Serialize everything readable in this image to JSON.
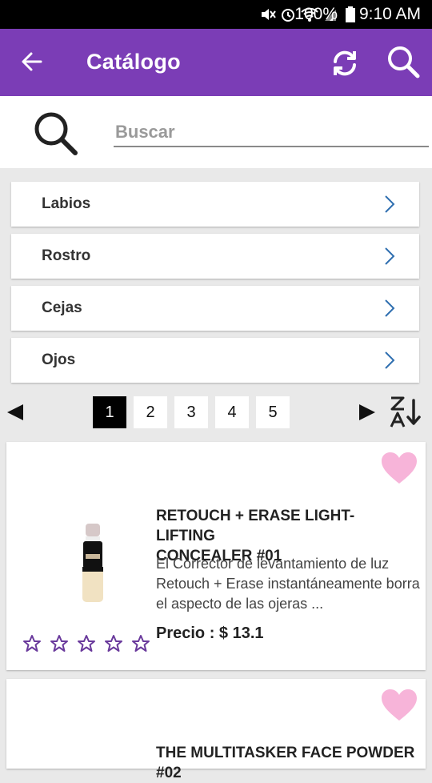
{
  "status": {
    "battery": "100%",
    "time": "9:10 AM"
  },
  "appbar": {
    "title": "Catálogo"
  },
  "search": {
    "placeholder": "Buscar"
  },
  "categories": [
    {
      "label": "Labios"
    },
    {
      "label": "Rostro"
    },
    {
      "label": "Cejas"
    },
    {
      "label": "Ojos"
    }
  ],
  "pagination": {
    "pages": [
      "1",
      "2",
      "3",
      "4",
      "5"
    ],
    "current": "1"
  },
  "products": [
    {
      "name_line1": "RETOUCH + ERASE LIGHT-LIFTING",
      "name_line2": "CONCEALER #01",
      "description": "El Corrector de levantamiento de luz Retouch + Erase instantáneamente borra el aspecto de las ojeras ...",
      "price": "Precio : $ 13.1",
      "rating": 0
    },
    {
      "name_line1": "THE MULTITASKER FACE POWDER #02"
    }
  ],
  "colors": {
    "accent": "#7b3db6",
    "heart": "#f7b4d9",
    "star_outline": "#6a3a9c"
  }
}
